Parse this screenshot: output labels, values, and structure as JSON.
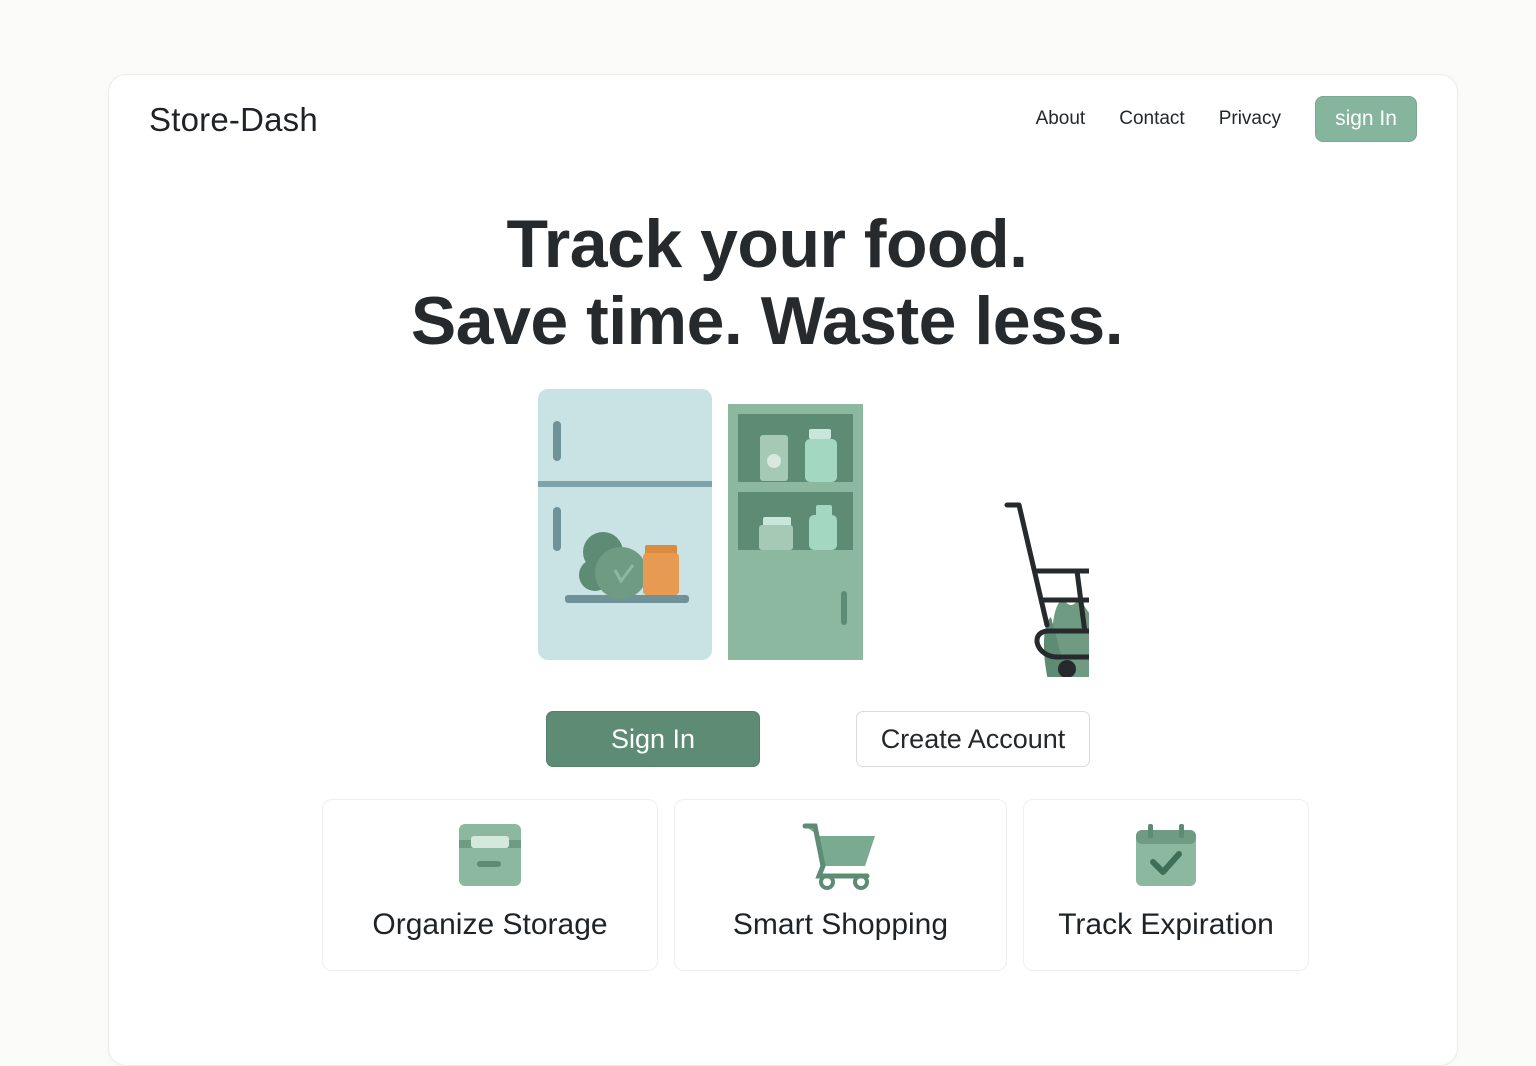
{
  "header": {
    "brand": "Store-Dash",
    "nav": [
      "About",
      "Contact",
      "Privacy"
    ],
    "signin_label": "sign In"
  },
  "hero": {
    "line1": "Track your food.",
    "line2": "Save time. Waste less."
  },
  "actions": {
    "primary_label": "Sign In",
    "secondary_label": "Create Account"
  },
  "features": [
    {
      "label": "Organize Storage",
      "icon": "storage-box-icon"
    },
    {
      "label": "Smart Shopping",
      "icon": "shopping-cart-icon"
    },
    {
      "label": "Track Expiration",
      "icon": "calendar-check-icon"
    }
  ],
  "colors": {
    "accent": "#86b59e",
    "accent_dark": "#5e8b74",
    "text": "#24282b",
    "fridge": "#c9e2e3",
    "pantry": "#8cb8a0"
  }
}
